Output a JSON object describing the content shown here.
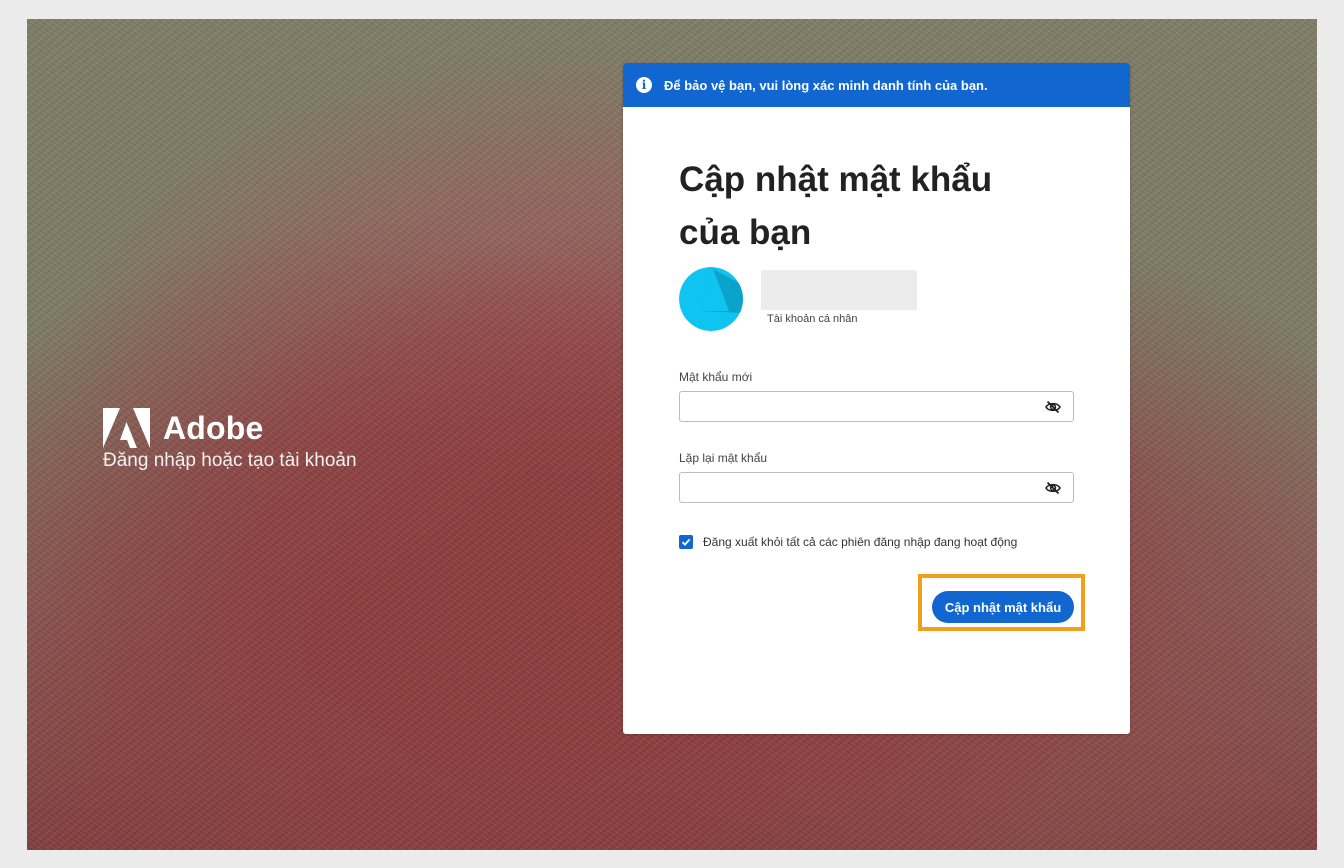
{
  "brand": {
    "name": "Adobe",
    "tagline": "Đăng nhập hoặc tạo tài khoản",
    "logo_icon": "adobe-logo-icon"
  },
  "banner": {
    "icon": "info-icon",
    "text": "Để bảo vệ bạn, vui lòng xác minh danh tính của bạn."
  },
  "form": {
    "title": "Cập nhật mật khẩu của bạn",
    "account": {
      "email": "",
      "type": "Tài khoản cá nhân"
    },
    "new_password_label": "Mật khẩu mới",
    "new_password_value": "",
    "repeat_password_label": "Lặp lại mật khẩu",
    "repeat_password_value": "",
    "signout_label": "Đăng xuất khỏi tất cả các phiên đăng nhập đang hoạt động",
    "signout_checked": true,
    "submit_label": "Cập nhật mật khẩu"
  },
  "colors": {
    "accent": "#1266d0",
    "highlight": "#f0a01a",
    "avatar": "#0fc4f0"
  }
}
